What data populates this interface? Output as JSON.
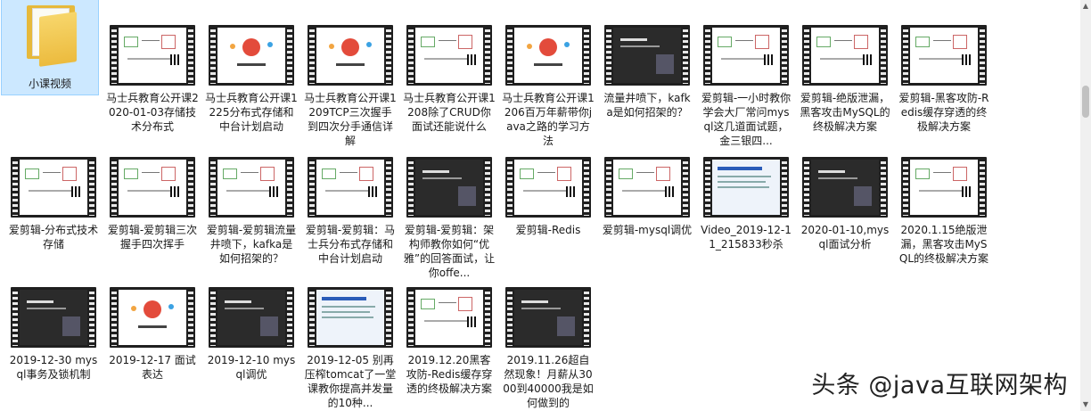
{
  "folder": {
    "label": "小课视频"
  },
  "items": [
    {
      "label": "马士兵教育公开课2020-01-03存储技术分布式",
      "kind": "diagram"
    },
    {
      "label": "马士兵教育公开课1225分布式存储和中台计划启动",
      "kind": "red"
    },
    {
      "label": "马士兵教育公开课1209TCP三次握手到四次分手通信详解",
      "kind": "red"
    },
    {
      "label": "马士兵教育公开课1208除了CRUD你面试还能说什么",
      "kind": "diagram"
    },
    {
      "label": "马士兵教育公开课1206百万年薪带你java之路的学习方法",
      "kind": "red"
    },
    {
      "label": "流量井喷下，kafka是如何招架的？",
      "kind": "dark"
    },
    {
      "label": "爱剪辑-一小时教你学会大厂常问mysql这几道面试题，金三银四...",
      "kind": "diagram"
    },
    {
      "label": "爱剪辑-绝版泄漏，黑客攻击MySQL的终极解决方案",
      "kind": "diagram"
    },
    {
      "label": "爱剪辑-黑客攻防-Redis缓存穿透的终极解决方案",
      "kind": "diagram"
    },
    {
      "label": "爱剪辑-分布式技术存储",
      "kind": "diagram"
    },
    {
      "label": "爱剪辑-爱剪辑三次握手四次挥手",
      "kind": "diagram"
    },
    {
      "label": "爱剪辑-爱剪辑流量井喷下，kafka是如何招架的？",
      "kind": "diagram"
    },
    {
      "label": "爱剪辑-爱剪辑：马士兵分布式存储和中台计划启动",
      "kind": "diagram"
    },
    {
      "label": "爱剪辑-爱剪辑：架构师教你如何“优雅”的回答面试，让你offe...",
      "kind": "dark"
    },
    {
      "label": "爱剪辑-Redis",
      "kind": "diagram"
    },
    {
      "label": "爱剪辑-mysql调优",
      "kind": "diagram"
    },
    {
      "label": "Video_2019-12-11_215833秒杀",
      "kind": "blue"
    },
    {
      "label": "2020-01-10,mysql面试分析",
      "kind": "dark"
    },
    {
      "label": "2020.1.15绝版泄漏，黑客攻击MySQL的终极解决方案",
      "kind": "diagram"
    },
    {
      "label": "2019-12-30 mysql事务及锁机制",
      "kind": "dark"
    },
    {
      "label": "2019-12-17 面试表达",
      "kind": "red"
    },
    {
      "label": "2019-12-10 mysql调优",
      "kind": "dark"
    },
    {
      "label": "2019-12-05 别再压榨tomcat了一堂课教你提高并发量的10种...",
      "kind": "blue"
    },
    {
      "label": "2019.12.20黑客攻防-Redis缓存穿透的终极解决方案",
      "kind": "diagram"
    },
    {
      "label": "2019.11.26超自然现象！月薪从3000到40000我是如何做到的",
      "kind": "dark"
    }
  ],
  "watermark": "头条 @java互联网架构",
  "colors": {
    "selection": "#cce8ff",
    "folder": "#ecbb3e",
    "film": "#1f1f1f"
  }
}
